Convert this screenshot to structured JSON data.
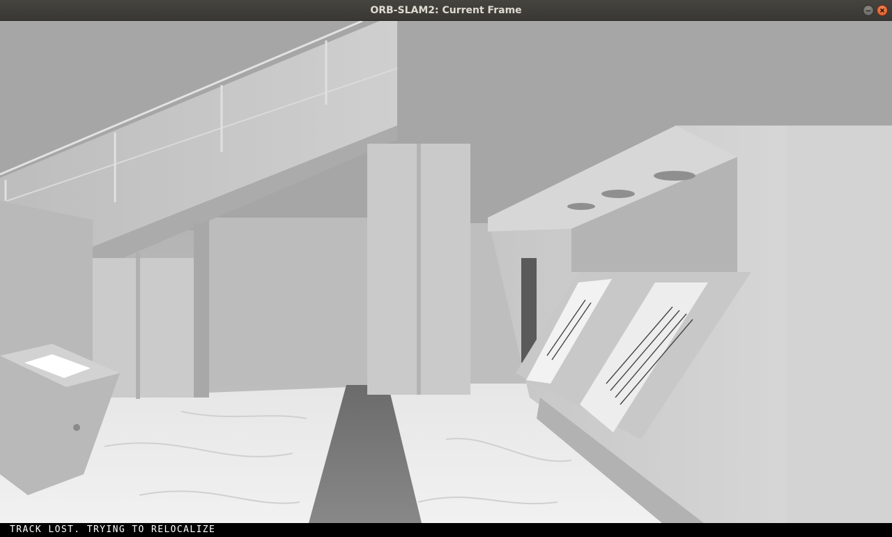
{
  "window": {
    "title": "ORB-SLAM2: Current Frame",
    "buttons": [
      "minimize-button",
      "close-button"
    ]
  },
  "viewport": {
    "content": "rendered camera frame of an indoor museum hall with staircase, pillars and exhibit display panels",
    "colors": {
      "accent_close": "#e0571f",
      "status_text": "#ffffff",
      "status_background": "#000000"
    }
  },
  "status": {
    "text": "TRACK LOST. TRYING TO RELOCALIZE"
  }
}
